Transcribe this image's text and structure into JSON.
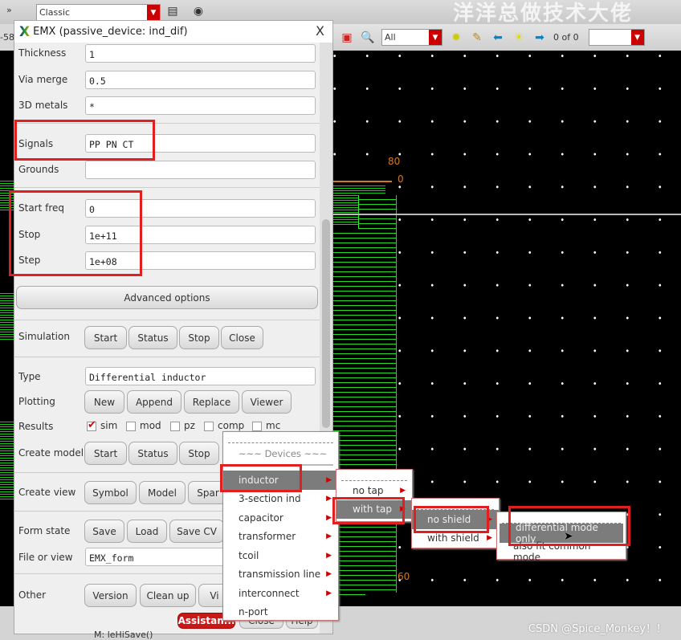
{
  "topbar": {
    "layout_select": "Classic",
    "watermark": "洋洋总做技术大佬",
    "coord_fragment": "-58"
  },
  "toolbar2": {
    "filter_select": "All",
    "count": "0 of 0",
    "search_value": ""
  },
  "canvas": {
    "ruler_labels": [
      "80",
      "0",
      "60"
    ]
  },
  "dialog": {
    "title": "EMX (passive_device: ind_dif)",
    "close": "X",
    "fields": [
      {
        "label": "Thickness",
        "value": "1"
      },
      {
        "label": "Via merge",
        "value": "0.5"
      },
      {
        "label": "3D metals",
        "value": "*"
      },
      {
        "label": "Signals",
        "value": "PP PN CT"
      },
      {
        "label": "Grounds",
        "value": ""
      },
      {
        "label": "Start freq",
        "value": "0"
      },
      {
        "label": "Stop",
        "value": "1e+11"
      },
      {
        "label": "Step",
        "value": "1e+08"
      }
    ],
    "advanced": "Advanced options",
    "simulation": {
      "label": "Simulation",
      "buttons": [
        "Start",
        "Status",
        "Stop",
        "Close"
      ]
    },
    "type": {
      "label": "Type",
      "value": "Differential inductor"
    },
    "plotting": {
      "label": "Plotting",
      "buttons": [
        "New",
        "Append",
        "Replace",
        "Viewer"
      ]
    },
    "results": {
      "label": "Results",
      "options": [
        {
          "label": "sim",
          "checked": true
        },
        {
          "label": "mod",
          "checked": false
        },
        {
          "label": "pz",
          "checked": false
        },
        {
          "label": "comp",
          "checked": false
        },
        {
          "label": "mc",
          "checked": false
        }
      ]
    },
    "create_model": {
      "label": "Create model",
      "buttons": [
        "Start",
        "Status",
        "Stop"
      ]
    },
    "create_view": {
      "label": "Create view",
      "buttons": [
        "Symbol",
        "Model",
        "Spar"
      ]
    },
    "form_state": {
      "label": "Form state",
      "buttons": [
        "Save",
        "Load",
        "Save CV"
      ]
    },
    "file_or_view": {
      "label": "File or view",
      "value": "EMX_form"
    },
    "other": {
      "label": "Other",
      "buttons": [
        "Version",
        "Clean up",
        "Vi"
      ]
    },
    "footer": {
      "assistant": "Assistan...",
      "close": "Close",
      "help": "Help"
    }
  },
  "status": "M: leHiSave()",
  "menus": {
    "devices": {
      "header": "~~~ Devices ~~~",
      "items": [
        "inductor",
        "3-section ind",
        "capacitor",
        "transformer",
        "tcoil",
        "transmission line",
        "interconnect",
        "n-port"
      ]
    },
    "inductor": {
      "items": [
        "no tap",
        "with tap"
      ]
    },
    "with_tap": {
      "items": [
        "no shield",
        "with shield"
      ]
    },
    "no_shield": {
      "items": [
        "differential mode only",
        "also fit common mode"
      ]
    }
  },
  "credit": "CSDN @Spice_Monkey！！",
  "colors": {
    "highlight": "#e02020",
    "menu_selected": "#7c7c7c",
    "layout_green": "#22dd22",
    "ruler": "#d07a20"
  }
}
